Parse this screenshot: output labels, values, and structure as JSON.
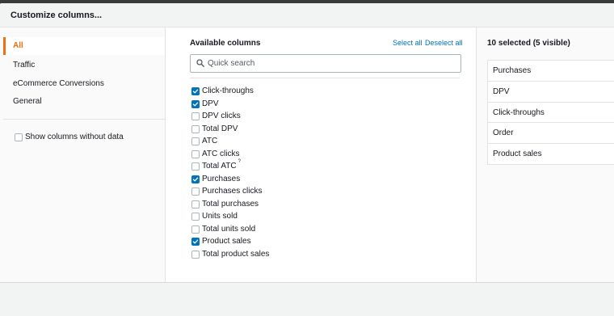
{
  "dialog": {
    "title": "Customize columns..."
  },
  "categories": [
    {
      "label": "All",
      "active": true
    },
    {
      "label": "Traffic",
      "active": false
    },
    {
      "label": "eCommerce Conversions",
      "active": false
    },
    {
      "label": "General",
      "active": false
    }
  ],
  "show_without_data": {
    "label": "Show columns without data",
    "checked": false
  },
  "available": {
    "title": "Available columns",
    "select_all": "Select all",
    "deselect_all": "Deselect all",
    "search_placeholder": "Quick search",
    "items": [
      {
        "label": "Click-throughs",
        "checked": true
      },
      {
        "label": "DPV",
        "checked": true
      },
      {
        "label": "DPV clicks",
        "checked": false
      },
      {
        "label": "Total DPV",
        "checked": false
      },
      {
        "label": "ATC",
        "checked": false
      },
      {
        "label": "ATC clicks",
        "checked": false
      },
      {
        "label": "Total ATC",
        "checked": false,
        "note": "?"
      },
      {
        "label": "Purchases",
        "checked": true
      },
      {
        "label": "Purchases clicks",
        "checked": false
      },
      {
        "label": "Total purchases",
        "checked": false
      },
      {
        "label": "Units sold",
        "checked": false
      },
      {
        "label": "Total units sold",
        "checked": false
      },
      {
        "label": "Product sales",
        "checked": true
      },
      {
        "label": "Total product sales",
        "checked": false
      }
    ]
  },
  "selected": {
    "title": "10 selected (5 visible)",
    "items": [
      "Purchases",
      "DPV",
      "Click-throughs",
      "Order",
      "Product sales"
    ]
  },
  "colors": {
    "accent": "#ec7211",
    "link": "#0073bb",
    "checkbox_checked": "#0073bb"
  }
}
